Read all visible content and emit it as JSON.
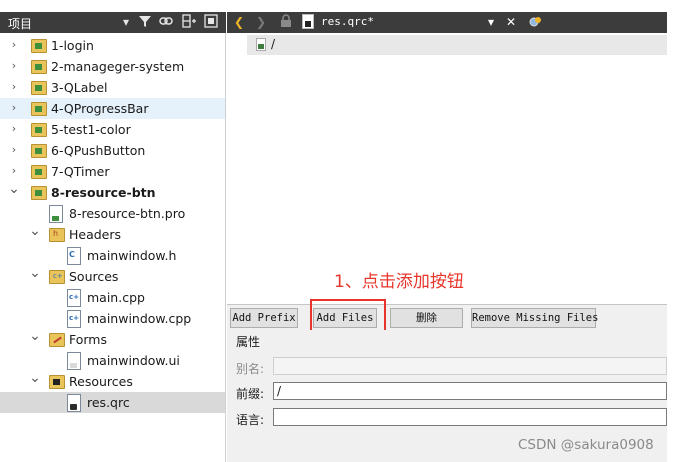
{
  "project_panel": {
    "title": "项目",
    "tree": [
      {
        "label": "1-login",
        "level": 0,
        "expanded": false,
        "kind": "project"
      },
      {
        "label": "2-manageger-system",
        "level": 0,
        "expanded": false,
        "kind": "project"
      },
      {
        "label": "3-QLabel",
        "level": 0,
        "expanded": false,
        "kind": "project"
      },
      {
        "label": "4-QProgressBar",
        "level": 0,
        "expanded": false,
        "kind": "project",
        "state": "hover"
      },
      {
        "label": "5-test1-color",
        "level": 0,
        "expanded": false,
        "kind": "project"
      },
      {
        "label": "6-QPushButton",
        "level": 0,
        "expanded": false,
        "kind": "project"
      },
      {
        "label": "7-QTimer",
        "level": 0,
        "expanded": false,
        "kind": "project"
      },
      {
        "label": "8-resource-btn",
        "level": 0,
        "expanded": true,
        "kind": "project",
        "bold": true
      },
      {
        "label": "8-resource-btn.pro",
        "level": 1,
        "kind": "pro-file"
      },
      {
        "label": "Headers",
        "level": 1,
        "expanded": true,
        "kind": "headers-folder"
      },
      {
        "label": "mainwindow.h",
        "level": 2,
        "kind": "header-file"
      },
      {
        "label": "Sources",
        "level": 1,
        "expanded": true,
        "kind": "sources-folder"
      },
      {
        "label": "main.cpp",
        "level": 2,
        "kind": "cpp-file"
      },
      {
        "label": "mainwindow.cpp",
        "level": 2,
        "kind": "cpp-file"
      },
      {
        "label": "Forms",
        "level": 1,
        "expanded": true,
        "kind": "forms-folder"
      },
      {
        "label": "mainwindow.ui",
        "level": 2,
        "kind": "ui-file"
      },
      {
        "label": "Resources",
        "level": 1,
        "expanded": true,
        "kind": "resources-folder"
      },
      {
        "label": "res.qrc",
        "level": 2,
        "kind": "qrc-file",
        "state": "selected"
      }
    ]
  },
  "editor": {
    "file_name": "res.qrc*",
    "root_prefix": "/"
  },
  "annotation": "1、点击添加按钮",
  "buttons": {
    "add_prefix": "Add Prefix",
    "add_files": "Add Files",
    "delete": "删除",
    "remove_missing": "Remove Missing Files"
  },
  "properties": {
    "title": "属性",
    "alias_label": "别名:",
    "alias_value": "",
    "prefix_label": "前缀:",
    "prefix_value": "/",
    "language_label": "语言:",
    "language_value": ""
  },
  "watermark": "CSDN @sakura0908",
  "colors": {
    "annotation": "#e8352b",
    "toolbar": "#3c3c3c",
    "hover": "#e5f1fb",
    "selected": "#d9d9d9"
  }
}
